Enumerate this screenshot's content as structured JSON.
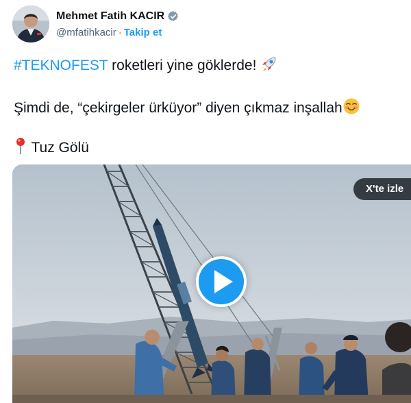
{
  "author": {
    "display_name": "Mehmet Fatih KACIR",
    "handle": "@mfatihkacir",
    "separator": "·",
    "follow_label": "Takip et",
    "verified_color": "#829aab"
  },
  "tweet": {
    "hashtag": "#TEKNOFEST",
    "line1_rest": " roketleri yine göklerde! ",
    "line1_emoji": "rocket-emoji",
    "line2": "Şimdi de, “çekirgeler ürküyor” diyen çıkmaz inşallah",
    "line2_emoji": "smiling-face-emoji",
    "location_emoji": "round-pushpin-emoji",
    "line3": "Tuz Gölü"
  },
  "media": {
    "watch_label": "X'te izle",
    "play_icon": "play-icon",
    "accent": "#1d9bf0"
  }
}
